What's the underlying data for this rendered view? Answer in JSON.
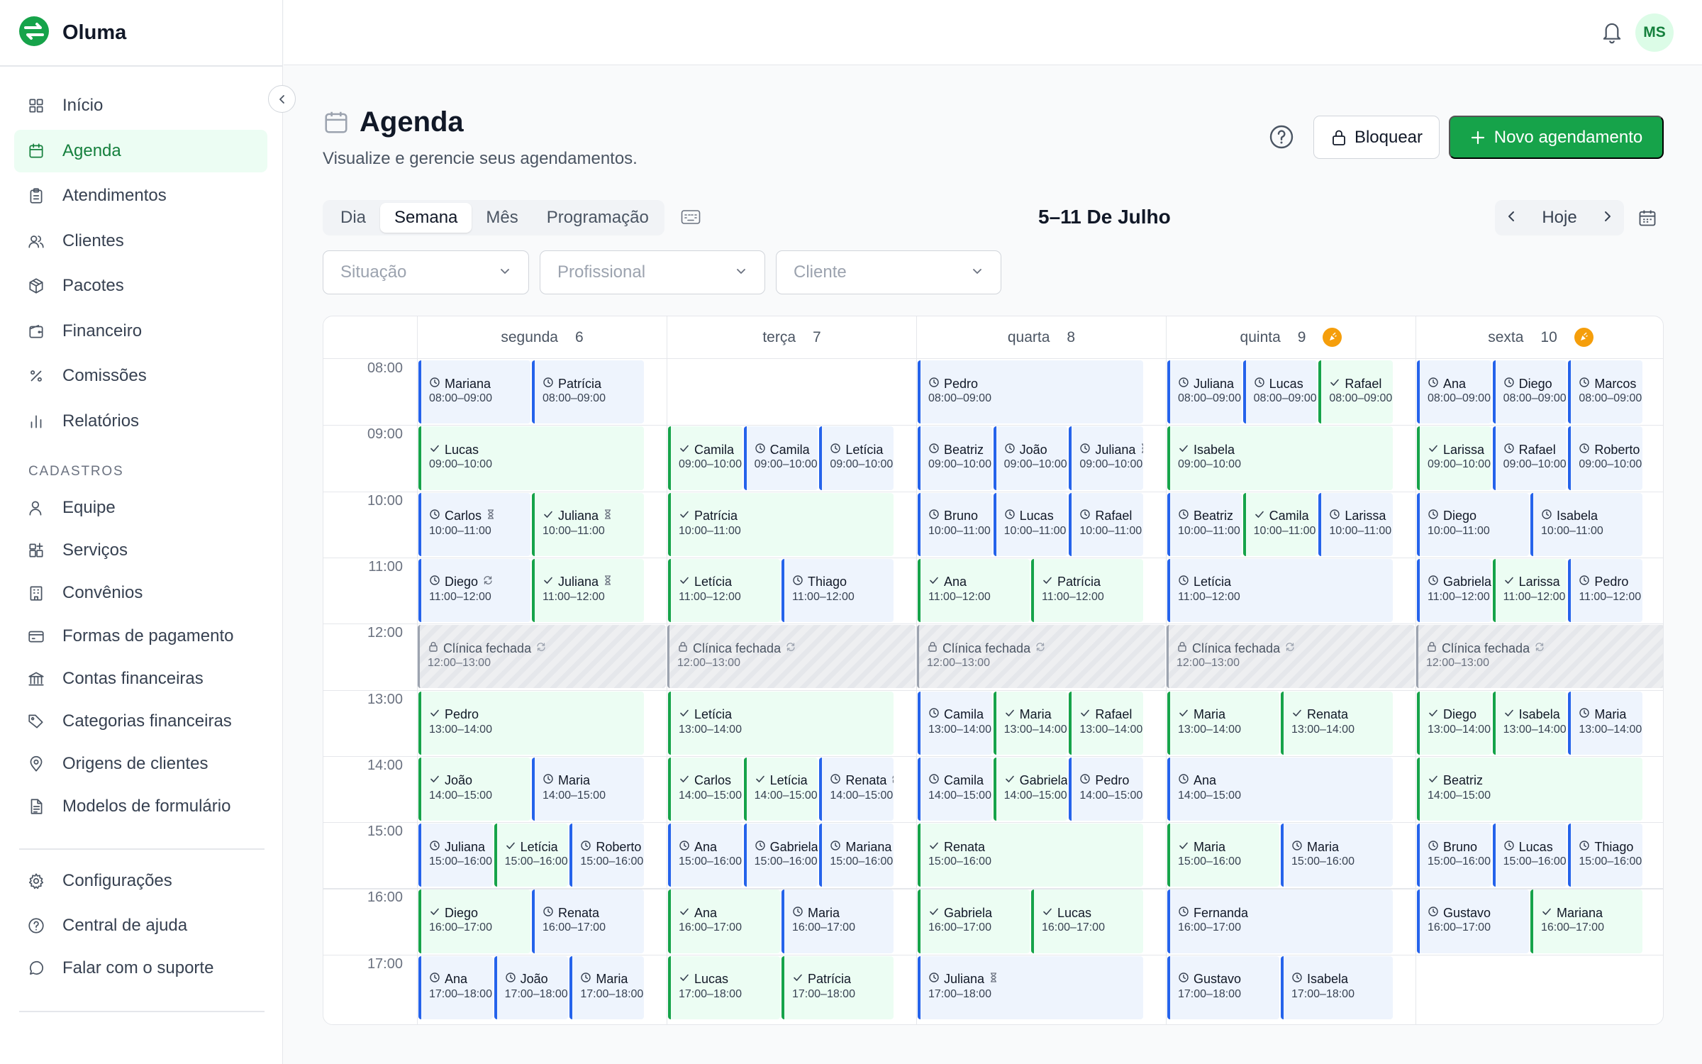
{
  "app": {
    "name": "Oluma",
    "user_initials": "MS"
  },
  "sidebar": {
    "items": [
      {
        "label": "Início",
        "icon": "grid-icon",
        "active": false
      },
      {
        "label": "Agenda",
        "icon": "calendar-icon",
        "active": true
      },
      {
        "label": "Atendimentos",
        "icon": "clipboard-icon",
        "active": false
      },
      {
        "label": "Clientes",
        "icon": "users-icon",
        "active": false
      },
      {
        "label": "Pacotes",
        "icon": "package-icon",
        "active": false
      },
      {
        "label": "Financeiro",
        "icon": "wallet-icon",
        "active": false
      },
      {
        "label": "Comissões",
        "icon": "percent-icon",
        "active": false
      },
      {
        "label": "Relatórios",
        "icon": "bar-chart-icon",
        "active": false
      }
    ],
    "section_title": "CADASTROS",
    "cadastros": [
      {
        "label": "Equipe",
        "icon": "user-icon"
      },
      {
        "label": "Serviços",
        "icon": "apps-plus-icon"
      },
      {
        "label": "Convênios",
        "icon": "building-icon"
      },
      {
        "label": "Formas de pagamento",
        "icon": "credit-card-icon"
      },
      {
        "label": "Contas financeiras",
        "icon": "bank-icon"
      },
      {
        "label": "Categorias financeiras",
        "icon": "tag-icon"
      },
      {
        "label": "Origens de clientes",
        "icon": "map-pin-icon"
      },
      {
        "label": "Modelos de formulário",
        "icon": "file-text-icon"
      }
    ],
    "footer": [
      {
        "label": "Configurações",
        "icon": "gear-icon"
      },
      {
        "label": "Central de ajuda",
        "icon": "help-circle-icon"
      },
      {
        "label": "Falar com o suporte",
        "icon": "message-circle-icon"
      }
    ]
  },
  "page": {
    "title": "Agenda",
    "subtitle": "Visualize e gerencie seus agendamentos.",
    "block_label": "Bloquear",
    "new_label": "Novo agendamento"
  },
  "view_tabs": [
    {
      "label": "Dia",
      "active": false
    },
    {
      "label": "Semana",
      "active": true
    },
    {
      "label": "Mês",
      "active": false
    },
    {
      "label": "Programação",
      "active": false
    }
  ],
  "range_label": "5–11 De Julho",
  "today_label": "Hoje",
  "filters": [
    {
      "placeholder": "Situação"
    },
    {
      "placeholder": "Profissional"
    },
    {
      "placeholder": "Cliente"
    }
  ],
  "calendar": {
    "days": [
      {
        "name": "segunda",
        "num": "6",
        "holiday": false
      },
      {
        "name": "terça",
        "num": "7",
        "holiday": false
      },
      {
        "name": "quarta",
        "num": "8",
        "holiday": false
      },
      {
        "name": "quinta",
        "num": "9",
        "holiday": true
      },
      {
        "name": "sexta",
        "num": "10",
        "holiday": true
      }
    ],
    "hours": [
      "08:00",
      "09:00",
      "10:00",
      "11:00",
      "12:00",
      "13:00",
      "14:00",
      "15:00",
      "16:00",
      "17:00"
    ],
    "closed_label": "Clínica fechada",
    "closed_time": "12:00–13:00",
    "events": [
      {
        "day": 0,
        "hour": 0,
        "lane": 0,
        "lanes": 2,
        "name": "Mariana",
        "time": "08:00–09:00",
        "status": "pending"
      },
      {
        "day": 0,
        "hour": 0,
        "lane": 1,
        "lanes": 2,
        "name": "Patrícia",
        "time": "08:00–09:00",
        "status": "pending"
      },
      {
        "day": 0,
        "hour": 1,
        "lane": 0,
        "lanes": 1,
        "name": "Lucas",
        "time": "09:00–10:00",
        "status": "confirmed"
      },
      {
        "day": 0,
        "hour": 2,
        "lane": 0,
        "lanes": 2,
        "name": "Carlos",
        "time": "10:00–11:00",
        "status": "pending",
        "flag": "waiting"
      },
      {
        "day": 0,
        "hour": 2,
        "lane": 1,
        "lanes": 2,
        "name": "Juliana",
        "time": "10:00–11:00",
        "status": "confirmed",
        "flag": "waiting"
      },
      {
        "day": 0,
        "hour": 3,
        "lane": 0,
        "lanes": 2,
        "name": "Diego",
        "time": "11:00–12:00",
        "status": "pending",
        "flag": "repeat"
      },
      {
        "day": 0,
        "hour": 3,
        "lane": 1,
        "lanes": 2,
        "name": "Juliana",
        "time": "11:00–12:00",
        "status": "confirmed",
        "flag": "waiting"
      },
      {
        "day": 0,
        "hour": 5,
        "lane": 0,
        "lanes": 1,
        "name": "Pedro",
        "time": "13:00–14:00",
        "status": "confirmed"
      },
      {
        "day": 0,
        "hour": 6,
        "lane": 0,
        "lanes": 2,
        "name": "João",
        "time": "14:00–15:00",
        "status": "confirmed"
      },
      {
        "day": 0,
        "hour": 6,
        "lane": 1,
        "lanes": 2,
        "name": "Maria",
        "time": "14:00–15:00",
        "status": "pending"
      },
      {
        "day": 0,
        "hour": 7,
        "lane": 0,
        "lanes": 3,
        "name": "Juliana",
        "time": "15:00–16:00",
        "status": "pending"
      },
      {
        "day": 0,
        "hour": 7,
        "lane": 1,
        "lanes": 3,
        "name": "Letícia",
        "time": "15:00–16:00",
        "status": "confirmed"
      },
      {
        "day": 0,
        "hour": 7,
        "lane": 2,
        "lanes": 3,
        "name": "Roberto",
        "time": "15:00–16:00",
        "status": "pending"
      },
      {
        "day": 0,
        "hour": 8,
        "lane": 0,
        "lanes": 2,
        "name": "Diego",
        "time": "16:00–17:00",
        "status": "confirmed"
      },
      {
        "day": 0,
        "hour": 8,
        "lane": 1,
        "lanes": 2,
        "name": "Renata",
        "time": "16:00–17:00",
        "status": "pending"
      },
      {
        "day": 0,
        "hour": 9,
        "lane": 0,
        "lanes": 3,
        "name": "Ana",
        "time": "17:00–18:00",
        "status": "pending"
      },
      {
        "day": 0,
        "hour": 9,
        "lane": 1,
        "lanes": 3,
        "name": "João",
        "time": "17:00–18:00",
        "status": "pending"
      },
      {
        "day": 0,
        "hour": 9,
        "lane": 2,
        "lanes": 3,
        "name": "Maria",
        "time": "17:00–18:00",
        "status": "pending"
      },
      {
        "day": 1,
        "hour": 1,
        "lane": 0,
        "lanes": 3,
        "name": "Camila",
        "time": "09:00–10:00",
        "status": "confirmed"
      },
      {
        "day": 1,
        "hour": 1,
        "lane": 1,
        "lanes": 3,
        "name": "Camila",
        "time": "09:00–10:00",
        "status": "pending"
      },
      {
        "day": 1,
        "hour": 1,
        "lane": 2,
        "lanes": 3,
        "name": "Letícia",
        "time": "09:00–10:00",
        "status": "pending"
      },
      {
        "day": 1,
        "hour": 2,
        "lane": 0,
        "lanes": 1,
        "name": "Patrícia",
        "time": "10:00–11:00",
        "status": "confirmed"
      },
      {
        "day": 1,
        "hour": 3,
        "lane": 0,
        "lanes": 2,
        "name": "Letícia",
        "time": "11:00–12:00",
        "status": "confirmed"
      },
      {
        "day": 1,
        "hour": 3,
        "lane": 1,
        "lanes": 2,
        "name": "Thiago",
        "time": "11:00–12:00",
        "status": "pending"
      },
      {
        "day": 1,
        "hour": 5,
        "lane": 0,
        "lanes": 1,
        "name": "Letícia",
        "time": "13:00–14:00",
        "status": "confirmed"
      },
      {
        "day": 1,
        "hour": 6,
        "lane": 0,
        "lanes": 3,
        "name": "Carlos",
        "time": "14:00–15:00",
        "status": "confirmed"
      },
      {
        "day": 1,
        "hour": 6,
        "lane": 1,
        "lanes": 3,
        "name": "Letícia",
        "time": "14:00–15:00",
        "status": "confirmed"
      },
      {
        "day": 1,
        "hour": 6,
        "lane": 2,
        "lanes": 3,
        "name": "Renata",
        "time": "14:00–15:00",
        "status": "pending",
        "flag": "repeat"
      },
      {
        "day": 1,
        "hour": 7,
        "lane": 0,
        "lanes": 3,
        "name": "Ana",
        "time": "15:00–16:00",
        "status": "pending"
      },
      {
        "day": 1,
        "hour": 7,
        "lane": 1,
        "lanes": 3,
        "name": "Gabriela",
        "time": "15:00–16:00",
        "status": "pending"
      },
      {
        "day": 1,
        "hour": 7,
        "lane": 2,
        "lanes": 3,
        "name": "Mariana",
        "time": "15:00–16:00",
        "status": "pending"
      },
      {
        "day": 1,
        "hour": 8,
        "lane": 0,
        "lanes": 2,
        "name": "Ana",
        "time": "16:00–17:00",
        "status": "confirmed"
      },
      {
        "day": 1,
        "hour": 8,
        "lane": 1,
        "lanes": 2,
        "name": "Maria",
        "time": "16:00–17:00",
        "status": "pending"
      },
      {
        "day": 1,
        "hour": 9,
        "lane": 0,
        "lanes": 2,
        "name": "Lucas",
        "time": "17:00–18:00",
        "status": "confirmed"
      },
      {
        "day": 1,
        "hour": 9,
        "lane": 1,
        "lanes": 2,
        "name": "Patrícia",
        "time": "17:00–18:00",
        "status": "confirmed"
      },
      {
        "day": 2,
        "hour": 0,
        "lane": 0,
        "lanes": 1,
        "name": "Pedro",
        "time": "08:00–09:00",
        "status": "pending"
      },
      {
        "day": 2,
        "hour": 1,
        "lane": 0,
        "lanes": 3,
        "name": "Beatriz",
        "time": "09:00–10:00",
        "status": "pending"
      },
      {
        "day": 2,
        "hour": 1,
        "lane": 1,
        "lanes": 3,
        "name": "João",
        "time": "09:00–10:00",
        "status": "pending"
      },
      {
        "day": 2,
        "hour": 1,
        "lane": 2,
        "lanes": 3,
        "name": "Juliana",
        "time": "09:00–10:00",
        "status": "pending",
        "flag": "waiting"
      },
      {
        "day": 2,
        "hour": 2,
        "lane": 0,
        "lanes": 3,
        "name": "Bruno",
        "time": "10:00–11:00",
        "status": "pending"
      },
      {
        "day": 2,
        "hour": 2,
        "lane": 1,
        "lanes": 3,
        "name": "Lucas",
        "time": "10:00–11:00",
        "status": "pending"
      },
      {
        "day": 2,
        "hour": 2,
        "lane": 2,
        "lanes": 3,
        "name": "Rafael",
        "time": "10:00–11:00",
        "status": "pending"
      },
      {
        "day": 2,
        "hour": 3,
        "lane": 0,
        "lanes": 2,
        "name": "Ana",
        "time": "11:00–12:00",
        "status": "confirmed"
      },
      {
        "day": 2,
        "hour": 3,
        "lane": 1,
        "lanes": 2,
        "name": "Patrícia",
        "time": "11:00–12:00",
        "status": "confirmed"
      },
      {
        "day": 2,
        "hour": 5,
        "lane": 0,
        "lanes": 3,
        "name": "Camila",
        "time": "13:00–14:00",
        "status": "pending"
      },
      {
        "day": 2,
        "hour": 5,
        "lane": 1,
        "lanes": 3,
        "name": "Maria",
        "time": "13:00–14:00",
        "status": "confirmed"
      },
      {
        "day": 2,
        "hour": 5,
        "lane": 2,
        "lanes": 3,
        "name": "Rafael",
        "time": "13:00–14:00",
        "status": "confirmed"
      },
      {
        "day": 2,
        "hour": 6,
        "lane": 0,
        "lanes": 3,
        "name": "Camila",
        "time": "14:00–15:00",
        "status": "pending"
      },
      {
        "day": 2,
        "hour": 6,
        "lane": 1,
        "lanes": 3,
        "name": "Gabriela",
        "time": "14:00–15:00",
        "status": "confirmed"
      },
      {
        "day": 2,
        "hour": 6,
        "lane": 2,
        "lanes": 3,
        "name": "Pedro",
        "time": "14:00–15:00",
        "status": "pending"
      },
      {
        "day": 2,
        "hour": 7,
        "lane": 0,
        "lanes": 1,
        "name": "Renata",
        "time": "15:00–16:00",
        "status": "confirmed"
      },
      {
        "day": 2,
        "hour": 8,
        "lane": 0,
        "lanes": 2,
        "name": "Gabriela",
        "time": "16:00–17:00",
        "status": "confirmed"
      },
      {
        "day": 2,
        "hour": 8,
        "lane": 1,
        "lanes": 2,
        "name": "Lucas",
        "time": "16:00–17:00",
        "status": "confirmed"
      },
      {
        "day": 2,
        "hour": 9,
        "lane": 0,
        "lanes": 1,
        "name": "Juliana",
        "time": "17:00–18:00",
        "status": "pending",
        "flag": "waiting"
      },
      {
        "day": 3,
        "hour": 0,
        "lane": 0,
        "lanes": 3,
        "name": "Juliana",
        "time": "08:00–09:00",
        "status": "pending"
      },
      {
        "day": 3,
        "hour": 0,
        "lane": 1,
        "lanes": 3,
        "name": "Lucas",
        "time": "08:00–09:00",
        "status": "pending"
      },
      {
        "day": 3,
        "hour": 0,
        "lane": 2,
        "lanes": 3,
        "name": "Rafael",
        "time": "08:00–09:00",
        "status": "confirmed"
      },
      {
        "day": 3,
        "hour": 1,
        "lane": 0,
        "lanes": 1,
        "name": "Isabela",
        "time": "09:00–10:00",
        "status": "confirmed"
      },
      {
        "day": 3,
        "hour": 2,
        "lane": 0,
        "lanes": 3,
        "name": "Beatriz",
        "time": "10:00–11:00",
        "status": "pending"
      },
      {
        "day": 3,
        "hour": 2,
        "lane": 1,
        "lanes": 3,
        "name": "Camila",
        "time": "10:00–11:00",
        "status": "confirmed"
      },
      {
        "day": 3,
        "hour": 2,
        "lane": 2,
        "lanes": 3,
        "name": "Larissa",
        "time": "10:00–11:00",
        "status": "pending"
      },
      {
        "day": 3,
        "hour": 3,
        "lane": 0,
        "lanes": 1,
        "name": "Letícia",
        "time": "11:00–12:00",
        "status": "pending"
      },
      {
        "day": 3,
        "hour": 5,
        "lane": 0,
        "lanes": 2,
        "name": "Maria",
        "time": "13:00–14:00",
        "status": "confirmed"
      },
      {
        "day": 3,
        "hour": 5,
        "lane": 1,
        "lanes": 2,
        "name": "Renata",
        "time": "13:00–14:00",
        "status": "confirmed"
      },
      {
        "day": 3,
        "hour": 6,
        "lane": 0,
        "lanes": 1,
        "name": "Ana",
        "time": "14:00–15:00",
        "status": "pending"
      },
      {
        "day": 3,
        "hour": 7,
        "lane": 0,
        "lanes": 2,
        "name": "Maria",
        "time": "15:00–16:00",
        "status": "confirmed"
      },
      {
        "day": 3,
        "hour": 7,
        "lane": 1,
        "lanes": 2,
        "name": "Maria",
        "time": "15:00–16:00",
        "status": "pending"
      },
      {
        "day": 3,
        "hour": 8,
        "lane": 0,
        "lanes": 1,
        "name": "Fernanda",
        "time": "16:00–17:00",
        "status": "pending"
      },
      {
        "day": 3,
        "hour": 9,
        "lane": 0,
        "lanes": 2,
        "name": "Gustavo",
        "time": "17:00–18:00",
        "status": "pending"
      },
      {
        "day": 3,
        "hour": 9,
        "lane": 1,
        "lanes": 2,
        "name": "Isabela",
        "time": "17:00–18:00",
        "status": "pending"
      },
      {
        "day": 4,
        "hour": 0,
        "lane": 0,
        "lanes": 3,
        "name": "Ana",
        "time": "08:00–09:00",
        "status": "pending"
      },
      {
        "day": 4,
        "hour": 0,
        "lane": 1,
        "lanes": 3,
        "name": "Diego",
        "time": "08:00–09:00",
        "status": "pending"
      },
      {
        "day": 4,
        "hour": 0,
        "lane": 2,
        "lanes": 3,
        "name": "Marcos",
        "time": "08:00–09:00",
        "status": "pending"
      },
      {
        "day": 4,
        "hour": 1,
        "lane": 0,
        "lanes": 3,
        "name": "Larissa",
        "time": "09:00–10:00",
        "status": "confirmed"
      },
      {
        "day": 4,
        "hour": 1,
        "lane": 1,
        "lanes": 3,
        "name": "Rafael",
        "time": "09:00–10:00",
        "status": "pending"
      },
      {
        "day": 4,
        "hour": 1,
        "lane": 2,
        "lanes": 3,
        "name": "Roberto",
        "time": "09:00–10:00",
        "status": "pending"
      },
      {
        "day": 4,
        "hour": 2,
        "lane": 0,
        "lanes": 2,
        "name": "Diego",
        "time": "10:00–11:00",
        "status": "pending"
      },
      {
        "day": 4,
        "hour": 2,
        "lane": 1,
        "lanes": 2,
        "name": "Isabela",
        "time": "10:00–11:00",
        "status": "pending"
      },
      {
        "day": 4,
        "hour": 3,
        "lane": 0,
        "lanes": 3,
        "name": "Gabriela",
        "time": "11:00–12:00",
        "status": "pending"
      },
      {
        "day": 4,
        "hour": 3,
        "lane": 1,
        "lanes": 3,
        "name": "Larissa",
        "time": "11:00–12:00",
        "status": "confirmed"
      },
      {
        "day": 4,
        "hour": 3,
        "lane": 2,
        "lanes": 3,
        "name": "Pedro",
        "time": "11:00–12:00",
        "status": "pending"
      },
      {
        "day": 4,
        "hour": 5,
        "lane": 0,
        "lanes": 3,
        "name": "Diego",
        "time": "13:00–14:00",
        "status": "confirmed"
      },
      {
        "day": 4,
        "hour": 5,
        "lane": 1,
        "lanes": 3,
        "name": "Isabela",
        "time": "13:00–14:00",
        "status": "confirmed"
      },
      {
        "day": 4,
        "hour": 5,
        "lane": 2,
        "lanes": 3,
        "name": "Maria",
        "time": "13:00–14:00",
        "status": "pending"
      },
      {
        "day": 4,
        "hour": 6,
        "lane": 0,
        "lanes": 1,
        "name": "Beatriz",
        "time": "14:00–15:00",
        "status": "confirmed"
      },
      {
        "day": 4,
        "hour": 7,
        "lane": 0,
        "lanes": 3,
        "name": "Bruno",
        "time": "15:00–16:00",
        "status": "pending"
      },
      {
        "day": 4,
        "hour": 7,
        "lane": 1,
        "lanes": 3,
        "name": "Lucas",
        "time": "15:00–16:00",
        "status": "pending"
      },
      {
        "day": 4,
        "hour": 7,
        "lane": 2,
        "lanes": 3,
        "name": "Thiago",
        "time": "15:00–16:00",
        "status": "pending"
      },
      {
        "day": 4,
        "hour": 8,
        "lane": 0,
        "lanes": 2,
        "name": "Gustavo",
        "time": "16:00–17:00",
        "status": "pending"
      },
      {
        "day": 4,
        "hour": 8,
        "lane": 1,
        "lanes": 2,
        "name": "Mariana",
        "time": "16:00–17:00",
        "status": "confirmed"
      }
    ]
  },
  "colors": {
    "accent": "#16a34a",
    "confirmed_bg": "#ecfdf3",
    "pending_bg": "#eef4fd",
    "pending_border": "#2563eb",
    "holiday": "#f59e0b"
  }
}
